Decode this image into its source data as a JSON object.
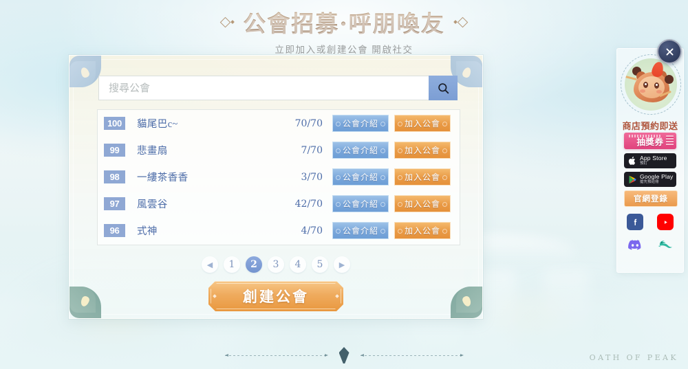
{
  "header": {
    "title": "公會招募·呼朋喚友",
    "subtitle": "立即加入或創建公會 開啟社交"
  },
  "search": {
    "placeholder": "搜尋公會",
    "value": "",
    "icon": "search-icon"
  },
  "list": {
    "columns": [
      "rank",
      "name",
      "members",
      "actions"
    ],
    "info_label": "公會介紹",
    "join_label": "加入公會",
    "rows": [
      {
        "rank": "100",
        "name": "貓尾巴c~",
        "members": "70/70"
      },
      {
        "rank": "99",
        "name": "悲畫扇",
        "members": "7/70"
      },
      {
        "rank": "98",
        "name": "一縷茶香香",
        "members": "3/70"
      },
      {
        "rank": "97",
        "name": "風雲谷",
        "members": "42/70"
      },
      {
        "rank": "96",
        "name": "式神",
        "members": "4/70"
      }
    ]
  },
  "pagination": {
    "prev": "◀",
    "next": "▶",
    "pages": [
      "1",
      "2",
      "3",
      "4",
      "5"
    ],
    "active": "2"
  },
  "create_button": {
    "label": "創建公會"
  },
  "sidebar": {
    "close_icon": "close-icon",
    "mascot": "mascot-character",
    "promo_title": "商店預約即送",
    "ticket_label": "抽獎券",
    "app_store": {
      "main": "App Store",
      "sub": "預訂"
    },
    "google_play": {
      "main": "Google Play",
      "sub": "搶先預註冊"
    },
    "official_label": "官網登錄",
    "social": [
      {
        "name": "facebook-icon",
        "glyph": "f"
      },
      {
        "name": "youtube-icon",
        "glyph": "▶"
      },
      {
        "name": "discord-icon",
        "glyph": ""
      },
      {
        "name": "bird-icon",
        "glyph": ""
      }
    ]
  },
  "footer": {
    "watermark": "OATH OF PEAK"
  },
  "colors": {
    "accent_blue": "#7c9ed4",
    "accent_orange": "#e9983f",
    "rank_badge": "#8fa8d4",
    "guild_name": "#4c6ca8",
    "title_brown": "#a07f61",
    "promo_red": "#b0573f",
    "ticket_pink": "#e0437d"
  }
}
